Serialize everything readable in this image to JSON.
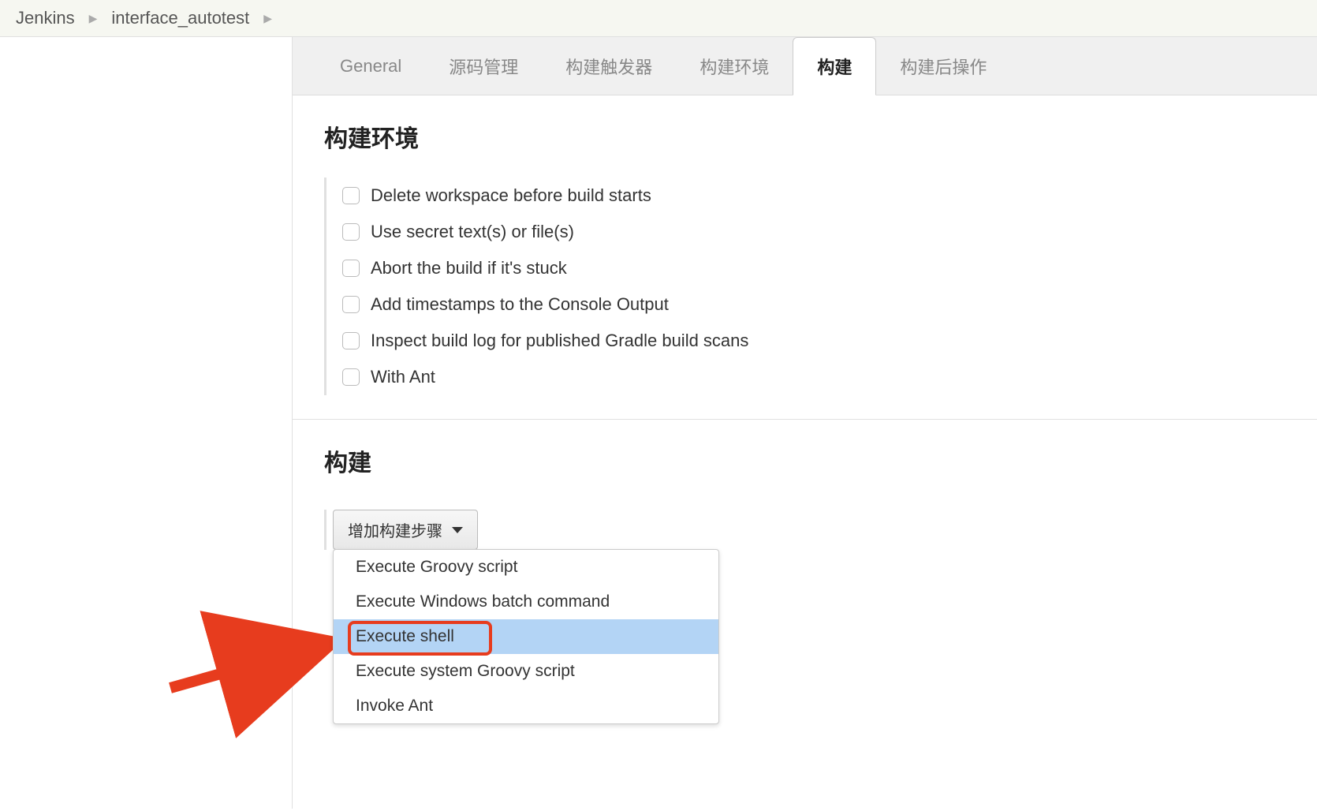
{
  "breadcrumb": {
    "root": "Jenkins",
    "project": "interface_autotest"
  },
  "tabs": [
    {
      "id": "general",
      "label": "General"
    },
    {
      "id": "scm",
      "label": "源码管理"
    },
    {
      "id": "trigger",
      "label": "构建触发器"
    },
    {
      "id": "env",
      "label": "构建环境"
    },
    {
      "id": "build",
      "label": "构建",
      "active": true
    },
    {
      "id": "post",
      "label": "构建后操作"
    }
  ],
  "buildEnv": {
    "heading": "构建环境",
    "options": [
      "Delete workspace before build starts",
      "Use secret text(s) or file(s)",
      "Abort the build if it's stuck",
      "Add timestamps to the Console Output",
      "Inspect build log for published Gradle build scans",
      "With Ant"
    ]
  },
  "build": {
    "heading": "构建",
    "addStepLabel": "增加构建步骤",
    "dropdown": [
      {
        "label": "Execute Groovy script"
      },
      {
        "label": "Execute Windows batch command"
      },
      {
        "label": "Execute shell",
        "highlighted": true
      },
      {
        "label": "Execute system Groovy script"
      },
      {
        "label": "Invoke Ant"
      }
    ]
  }
}
